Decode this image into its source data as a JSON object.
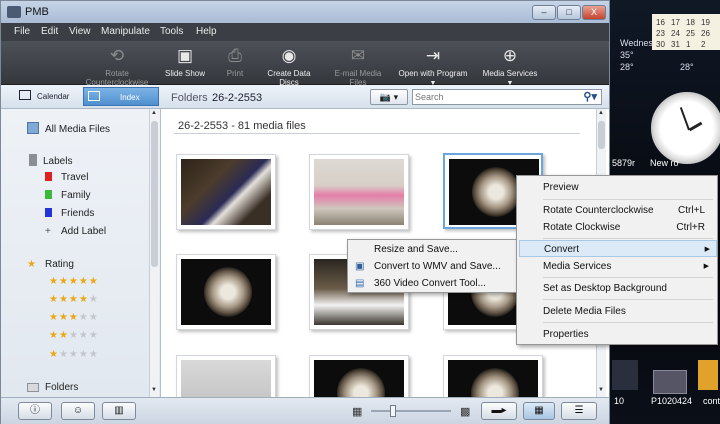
{
  "window": {
    "title": "PMB",
    "minimize": "–",
    "maximize": "□",
    "close": "X"
  },
  "menubar": [
    "File",
    "Edit",
    "View",
    "Manipulate",
    "Tools",
    "Help"
  ],
  "toolbar": {
    "rotate_ccw": "Rotate Counterclockwise",
    "slide_show": "Slide Show",
    "print": "Print",
    "create_discs": "Create Data Discs",
    "email": "E-mail Media Files",
    "open_with": "Open with Program",
    "media_services": "Media Services"
  },
  "nav": {
    "calendar": "Calendar",
    "index": "Index",
    "folders_label": "Folders",
    "folder_name": "26-2-2553",
    "search_placeholder": "Search"
  },
  "sidebar": {
    "all_media": "All Media Files",
    "labels_heading": "Labels",
    "labels": [
      {
        "name": "Travel",
        "color": "#e02020"
      },
      {
        "name": "Family",
        "color": "#3cb83c"
      },
      {
        "name": "Friends",
        "color": "#2435d8"
      }
    ],
    "add_label": "Add Label",
    "rating_heading": "Rating",
    "ratings": [
      5,
      4,
      3,
      2,
      1
    ],
    "folders": "Folders"
  },
  "content": {
    "header": "26-2-2553   -  81 media files"
  },
  "context_menu": {
    "items": [
      {
        "label": "Preview"
      },
      {
        "label": "Rotate Counterclockwise",
        "shortcut": "Ctrl+L"
      },
      {
        "label": "Rotate Clockwise",
        "shortcut": "Ctrl+R"
      },
      {
        "label": "Convert"
      },
      {
        "label": "Media Services"
      },
      {
        "label": "Set as Desktop Background"
      },
      {
        "label": "Delete Media Files"
      },
      {
        "label": "Properties"
      }
    ]
  },
  "submenu": {
    "items": [
      {
        "label": "Resize and Save..."
      },
      {
        "label": "Convert to WMV and Save..."
      },
      {
        "label": "360 Video Convert Tool..."
      }
    ]
  },
  "desktop": {
    "calendar_rows": [
      [
        "16",
        "17",
        "18",
        "19"
      ],
      [
        "23",
        "24",
        "25",
        "26"
      ],
      [
        "30",
        "31",
        "1",
        "2"
      ]
    ],
    "weather_day": "Wednes",
    "temp1": "35°",
    "temp2": "28°",
    "temp3": "28°",
    "clock_labels": [
      "5879r",
      "New ro"
    ],
    "bottom_labels": [
      "10",
      "P1020424",
      "cont"
    ]
  },
  "colors": {
    "accent": "#4f8fcf",
    "menubar": "#3b3f45",
    "toolbar": "#34373c"
  }
}
